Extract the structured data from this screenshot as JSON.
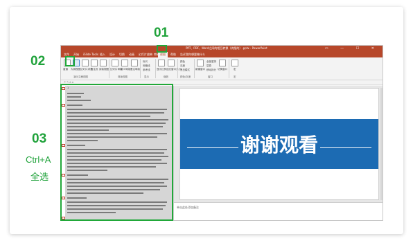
{
  "steps": {
    "step1": "01",
    "step2": "02",
    "step3": "03",
    "step3_line1": "Ctrl+A",
    "step3_line2": "全选"
  },
  "window": {
    "title": "PPT、PDF、Word之间的相互转换（终版的）.pptx - PowerPoint",
    "controls": "▭ — ☐ ✕"
  },
  "tabs": [
    "文件",
    "开始",
    "iSlide Tools",
    "插入",
    "设计",
    "切换",
    "动画",
    "幻灯片放映",
    "审阅",
    "视图",
    "帮助",
    "告诉我你想要做什么"
  ],
  "active_tab": "视图",
  "ribbon": {
    "buttons": [
      "普通",
      "大纲视图",
      "幻灯片浏览",
      "备注页",
      "阅读视图",
      "幻灯片母版",
      "讲义母版",
      "备注母版"
    ],
    "groups": [
      "演示文稿视图",
      "母版视图",
      "显示",
      "缩放",
      "颜色/灰度",
      "窗口",
      "宏"
    ],
    "show_items": [
      "标尺",
      "网格线",
      "参考线"
    ],
    "zoom_items": [
      "显示比例",
      "适应窗口大小"
    ],
    "color_items": [
      "颜色",
      "灰度",
      "黑白模式"
    ],
    "window_items": [
      "新建窗口",
      "全部重排",
      "层叠",
      "移动拆分",
      "切换窗口"
    ],
    "macro": "宏"
  },
  "outline": {
    "slide_numbers": [
      "1",
      "2",
      "3",
      "4",
      "5",
      "6",
      "7",
      "8",
      "9",
      "10"
    ]
  },
  "slide": {
    "text": "谢谢观看",
    "band_color": "#1c6bb3"
  },
  "notes": {
    "placeholder": "单击此处添加备注"
  },
  "colors": {
    "accent_green": "#1fa23a",
    "ppt_red": "#b7472a"
  }
}
